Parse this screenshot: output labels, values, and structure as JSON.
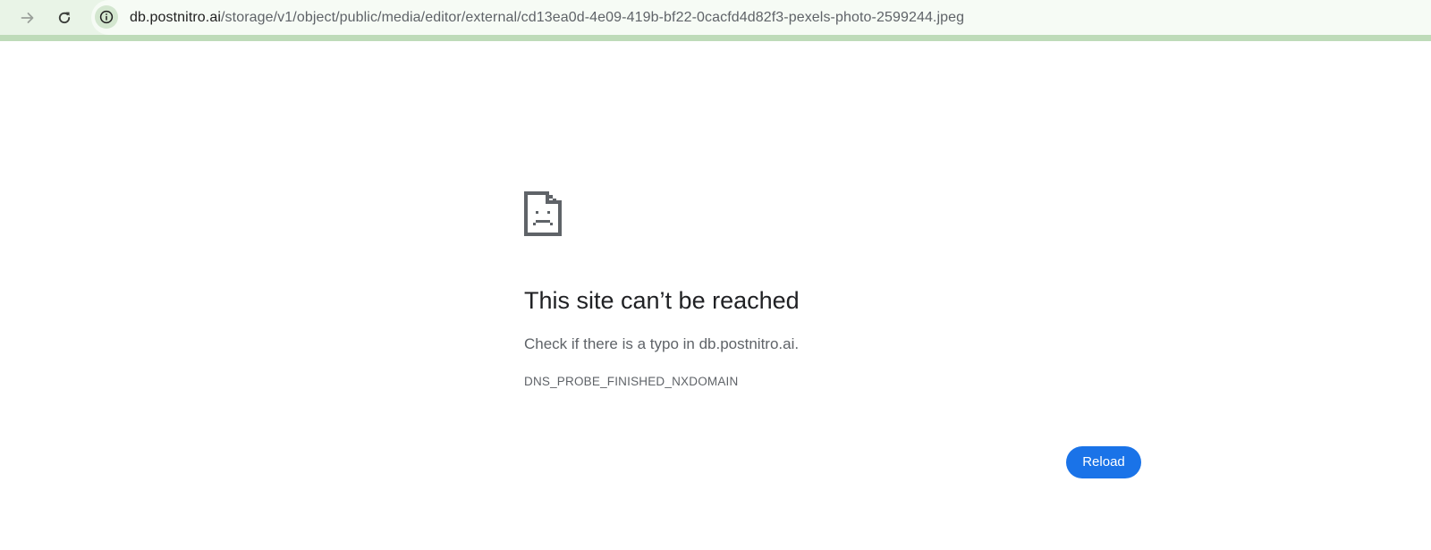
{
  "browser": {
    "nav": {
      "forward_icon": "arrow-forward-icon",
      "reload_icon": "reload-icon"
    },
    "omnibox": {
      "site_info_icon": "info-icon",
      "url_host": "db.postnitro.ai",
      "url_path": "/storage/v1/object/public/media/editor/external/cd13ea0d-4e09-419b-bf22-0cacfd4d82f3-pexels-photo-2599244.jpeg"
    },
    "colors": {
      "toolbar_bg": "#e9f4e7",
      "toolbar_line": "#bedbb9",
      "omnibox_bg": "#f6fbf5"
    }
  },
  "error_page": {
    "icon": "sad-page-icon",
    "title": "This site can’t be reached",
    "suggestion": "Check if there is a typo in db.postnitro.ai.",
    "error_code": "DNS_PROBE_FINISHED_NXDOMAIN",
    "reload_label": "Reload",
    "colors": {
      "button_bg": "#1a73e8",
      "heading": "#202124",
      "body_text": "#5f6368"
    }
  }
}
